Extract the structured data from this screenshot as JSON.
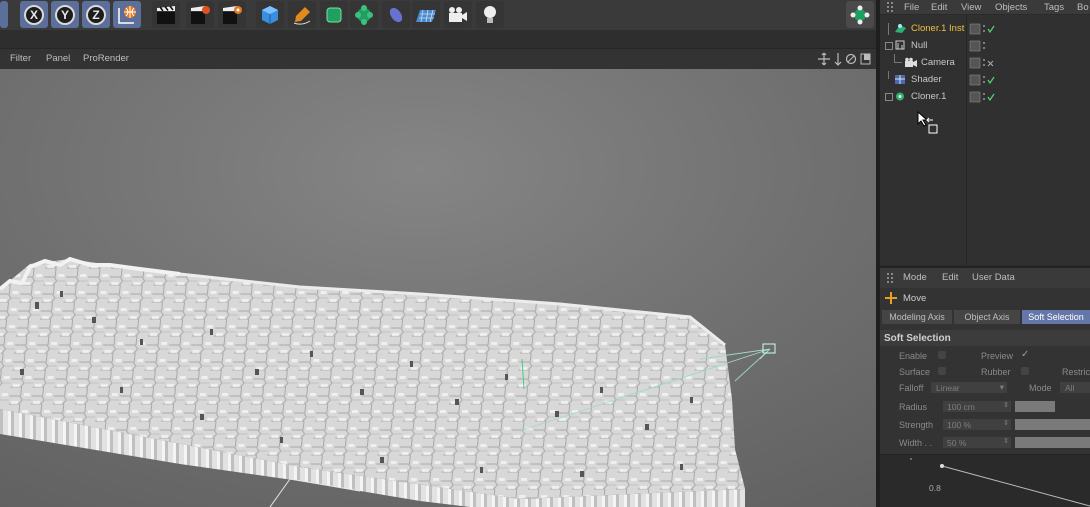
{
  "toolbar": {
    "axis_buttons": [
      "X",
      "Y",
      "Z"
    ],
    "icons": [
      "world-coordinates-icon",
      "render-view-icon",
      "render-picture-queue-icon",
      "render-settings-icon",
      "cube-icon",
      "pen-spline-icon",
      "subdivision-icon",
      "cloner-icon",
      "deformer-icon",
      "floor-grid-icon",
      "camera-icon",
      "light-bulb-icon"
    ]
  },
  "viewport": {
    "menu": [
      "Filter",
      "Panel",
      "ProRender"
    ]
  },
  "object_manager": {
    "menu": [
      "File",
      "Edit",
      "View",
      "Objects",
      "Tags",
      "Bo"
    ],
    "objects": [
      {
        "name": "Cloner.1 Inst",
        "highlighted": true
      },
      {
        "name": "Null"
      },
      {
        "name": "Camera"
      },
      {
        "name": "Shader"
      },
      {
        "name": "Cloner.1"
      }
    ]
  },
  "attributes": {
    "menu": [
      "Mode",
      "Edit",
      "User Data"
    ],
    "tool": "Move",
    "tabs": [
      "Modeling Axis",
      "Object Axis",
      "Soft Selection"
    ],
    "section_title": "Soft Selection",
    "enable": "Enable",
    "preview": "Preview",
    "surface": "Surface",
    "rubber": "Rubber",
    "restrict": "Restric",
    "falloff_label": "Falloff",
    "falloff_value": "Linear",
    "mode_label": "Mode",
    "mode_value": "All",
    "radius_label": "Radius",
    "radius_value": "100 cm",
    "strength_label": "Strength",
    "strength_value": "100 %",
    "width_label": "Width . .",
    "width_value": "50 %",
    "graph_tick": "0.8"
  },
  "colors": {
    "accent": "#5b6f9a",
    "highlight_text": "#f0c040",
    "active_tab": "#6477a8"
  }
}
